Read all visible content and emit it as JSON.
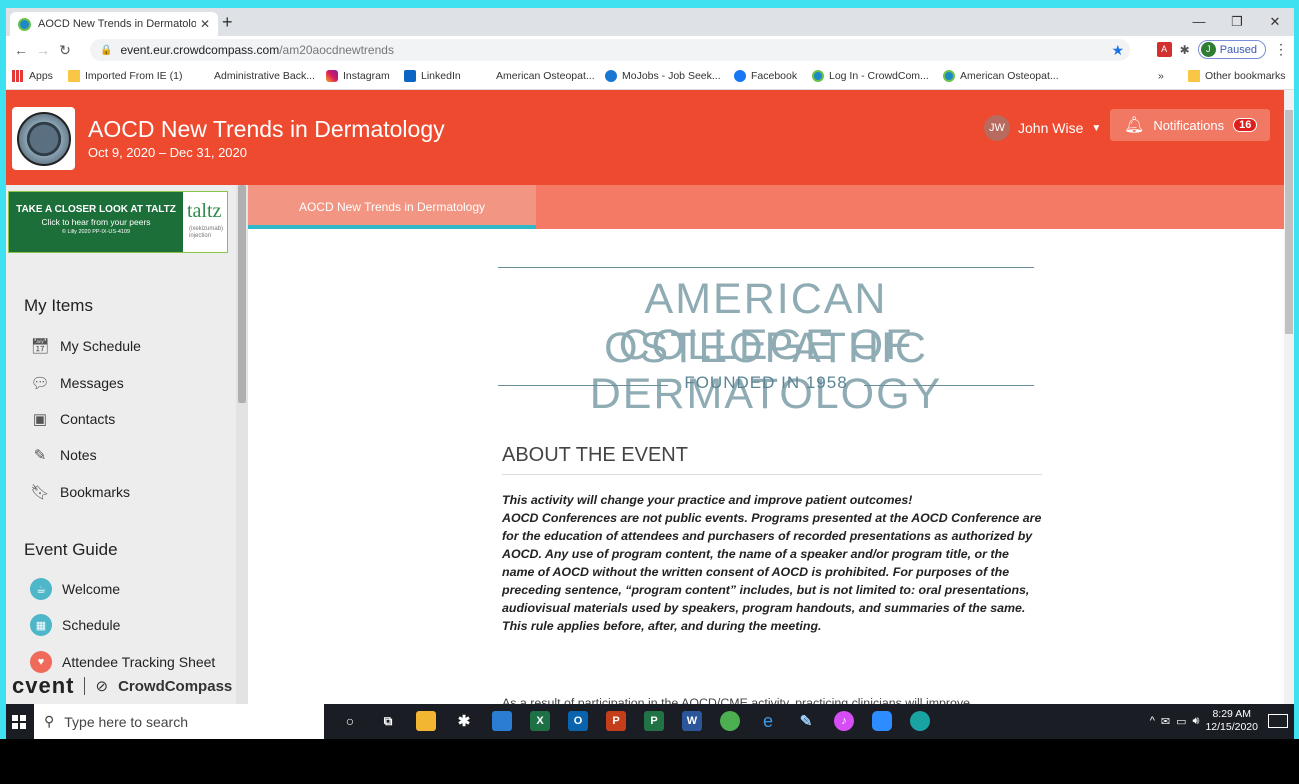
{
  "browser": {
    "tab_title": "AOCD New Trends in Dermatology",
    "new_tab": "+",
    "url_host": "event.eur.crowdcompass.com",
    "url_path": "/am20aocdnewtrends",
    "profile_initial": "J",
    "profile_status": "Paused",
    "bookmarks": [
      "Apps",
      "Imported From IE (1)",
      "Administrative Back...",
      "Instagram",
      "LinkedIn",
      "American Osteopat...",
      "MoJobs - Job Seek...",
      "Facebook",
      "Log In - CrowdCom...",
      "American Osteopat..."
    ],
    "bookmarks_more": "»",
    "other_bookmarks": "Other bookmarks"
  },
  "header": {
    "event_title": "AOCD New Trends in Dermatology",
    "event_dates": "Oct 9, 2020 – Dec 31, 2020",
    "user_initials": "JW",
    "user_name": "John Wise",
    "notifications_label": "Notifications",
    "notifications_count": "16"
  },
  "ad": {
    "line1": "TAKE A CLOSER LOOK AT TALTZ",
    "line2": "Click to hear from your peers",
    "line3": "© Lilly 2020 PP-IX-US-4109",
    "brand": "taltz",
    "sub": "(ixekizumab) injection"
  },
  "sidebar": {
    "my_items_title": "My Items",
    "my_items": [
      "My Schedule",
      "Messages",
      "Contacts",
      "Notes",
      "Bookmarks"
    ],
    "event_guide_title": "Event Guide",
    "guide_items": [
      "Welcome",
      "Schedule",
      "Attendee Tracking Sheet"
    ],
    "footer_cvent": "cvent",
    "footer_crowdcompass": "CrowdCompass"
  },
  "main": {
    "tab_label": "AOCD New Trends in Dermatology",
    "college_line1": "AMERICAN OSTEOPATHIC",
    "college_line2": "COLLEGE OF DERMATOLOGY",
    "college_founded": "FOUNDED IN 1958",
    "about_heading": "ABOUT THE EVENT",
    "about_text": "This activity will change your practice and improve patient outcomes!\nAOCD Conferences are not public events. Programs presented at the AOCD Conference are for the education of attendees and purchasers of recorded presentations as authorized by AOCD. Any use of program content, the name of a speaker and/or program title, or the name of AOCD without the written consent of AOCD is prohibited. For purposes of the preceding sentence, “program content” includes, but is not limited to: oral presentations, audiovisual materials used by speakers, program handouts, and summaries of the same. This rule applies before, after, and during the meeting.",
    "more_text": "As a result of participation in the AOCD/CME activity, practicing clinicians will improve"
  },
  "taskbar": {
    "search_placeholder": "Type here to search",
    "time": "8:29 AM",
    "date": "12/15/2020"
  },
  "colors": {
    "header": "#ee4a2f",
    "tab_bar": "#f47a66",
    "accent": "#2fb8c9",
    "frame": "#3fe0f0"
  }
}
